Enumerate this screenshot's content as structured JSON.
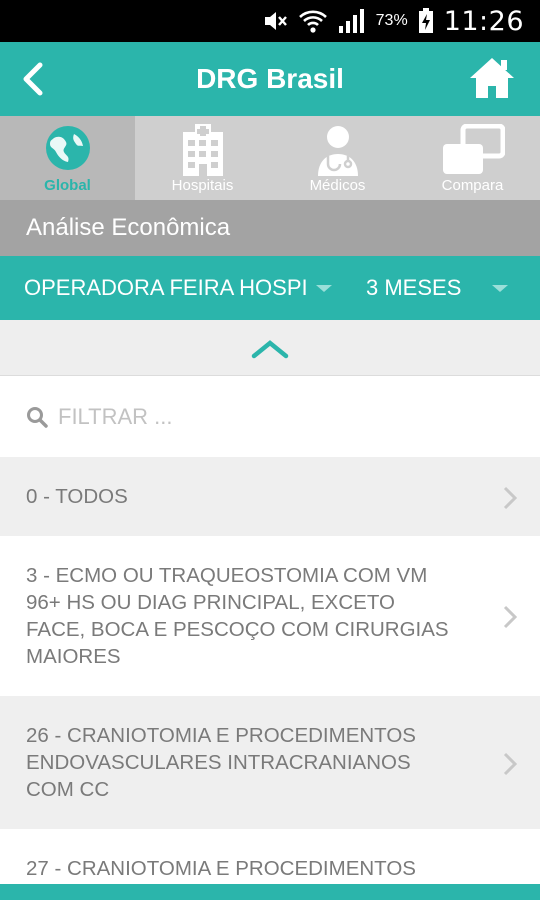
{
  "status_bar": {
    "battery": "73%",
    "time": "11:26",
    "icons": [
      "mute-icon",
      "wifi-icon",
      "signal-icon",
      "battery-icon"
    ]
  },
  "app_bar": {
    "title": "DRG Brasil",
    "back_icon": "back-arrow-icon",
    "home_icon": "home-icon"
  },
  "tabs": [
    {
      "label": "Global",
      "icon": "globe-icon",
      "active": true
    },
    {
      "label": "Hospitais",
      "icon": "hospital-building-icon",
      "active": false
    },
    {
      "label": "Médicos",
      "icon": "doctor-icon",
      "active": false
    },
    {
      "label": "Compara",
      "icon": "compare-icon",
      "active": false
    }
  ],
  "section": {
    "title": "Análise Econômica"
  },
  "filters": {
    "operadora": "OPERADORA FEIRA HOSPITAL",
    "periodo": "3 MESES"
  },
  "search": {
    "placeholder": "FILTRAR ..."
  },
  "list": {
    "items": [
      {
        "label": "0 - TODOS"
      },
      {
        "label": "3 - ECMO OU TRAQUEOSTOMIA COM VM 96+ HS OU DIAG PRINCIPAL, EXCETO FACE, BOCA E PESCOÇO COM CIRURGIAS MAIORES"
      },
      {
        "label": "26 - CRANIOTOMIA E PROCEDIMENTOS ENDOVASCULARES INTRACRANIANOS COM CC"
      },
      {
        "label": "27 - CRANIOTOMIA E PROCEDIMENTOS"
      }
    ]
  },
  "colors": {
    "accent": "#2bb5ab",
    "tab_bar": "#cfcfcf",
    "section_header": "#a3a3a3",
    "list_text": "#7a7a7a"
  }
}
